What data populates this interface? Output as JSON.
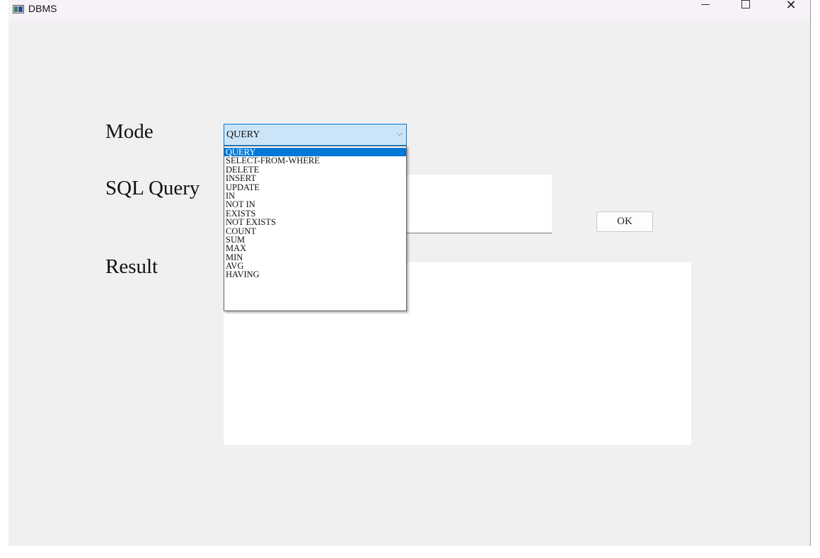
{
  "window": {
    "title": "DBMS",
    "minimize_icon": "minimize-icon",
    "maximize_icon": "maximize-icon",
    "close_icon": "close-icon",
    "close_glyph": "✕"
  },
  "form": {
    "mode_label": "Mode",
    "sql_label": "SQL Query",
    "result_label": "Result",
    "ok_label": "OK",
    "sql_value": "",
    "result_value": ""
  },
  "mode_combo": {
    "value": "QUERY",
    "arrow": "⌵",
    "options": [
      "QUERY",
      "SELECT-FROM-WHERE",
      "DELETE",
      "INSERT",
      "UPDATE",
      "IN",
      "NOT IN",
      "EXISTS",
      "NOT EXISTS",
      "COUNT",
      "SUM",
      "MAX",
      "MIN",
      "AVG",
      "HAVING"
    ],
    "selected_index": 0
  },
  "colors": {
    "selection": "#0078d7",
    "combo_background": "#cce4f7",
    "window_background": "#f0f0f0"
  }
}
